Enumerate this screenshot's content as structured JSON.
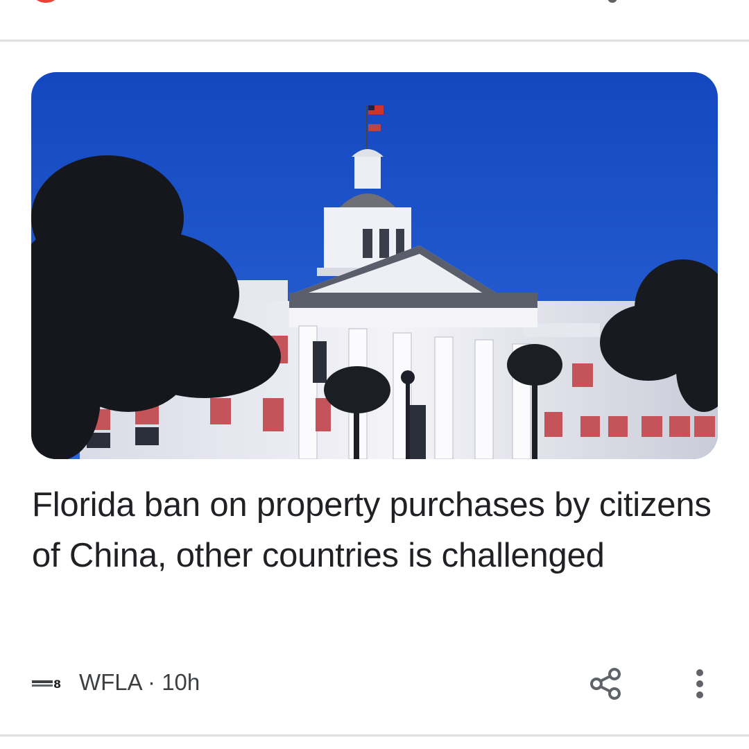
{
  "article": {
    "headline": "Florida ban on property purchases by citizens of China, other countries is challenged",
    "source": {
      "name": "WFLA",
      "separator": "·",
      "age": "10h",
      "logo_icon": "news-channel-8-logo"
    },
    "image_subject": "florida-capitol-building"
  },
  "actions": {
    "share_icon": "share-icon",
    "more_icon": "more-vert-icon"
  },
  "colors": {
    "sky": "#1f56c9",
    "text": "#202124",
    "meta": "#3c4043",
    "icon": "#5f6368",
    "divider": "#e0e0e0",
    "accent_red": "#ea4335"
  }
}
